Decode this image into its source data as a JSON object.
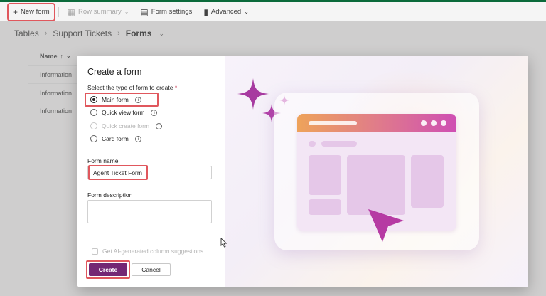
{
  "toolbar": {
    "new_form": "New form",
    "row_summary": "Row summary",
    "form_settings": "Form settings",
    "advanced": "Advanced"
  },
  "breadcrumb": {
    "tables": "Tables",
    "table": "Support Tickets",
    "current": "Forms"
  },
  "grid": {
    "column_header": "Name",
    "sort_indicator": "↑",
    "rows": [
      "Information",
      "Information",
      "Information"
    ]
  },
  "dialog": {
    "title": "Create a form",
    "type_label": "Select the type of form to create",
    "required_marker": "*",
    "form_types": [
      {
        "label": "Main form",
        "selected": true,
        "enabled": true
      },
      {
        "label": "Quick view form",
        "selected": false,
        "enabled": true
      },
      {
        "label": "Quick create form",
        "selected": false,
        "enabled": false
      },
      {
        "label": "Card form",
        "selected": false,
        "enabled": true
      }
    ],
    "form_name_label": "Form name",
    "form_name_value": "Agent Ticket Form",
    "form_description_label": "Form description",
    "form_description_value": "",
    "ai_suggestions_label": "Get AI-generated column suggestions",
    "create_button": "Create",
    "cancel_button": "Cancel"
  },
  "colors": {
    "accent": "#742774",
    "highlight": "#e0575d",
    "topbar": "#0b6a3b"
  },
  "icons": {
    "new_form": "plus-icon",
    "row_summary": "summary-icon",
    "form_settings": "form-settings-icon",
    "advanced": "advanced-icon",
    "info": "info-icon"
  }
}
